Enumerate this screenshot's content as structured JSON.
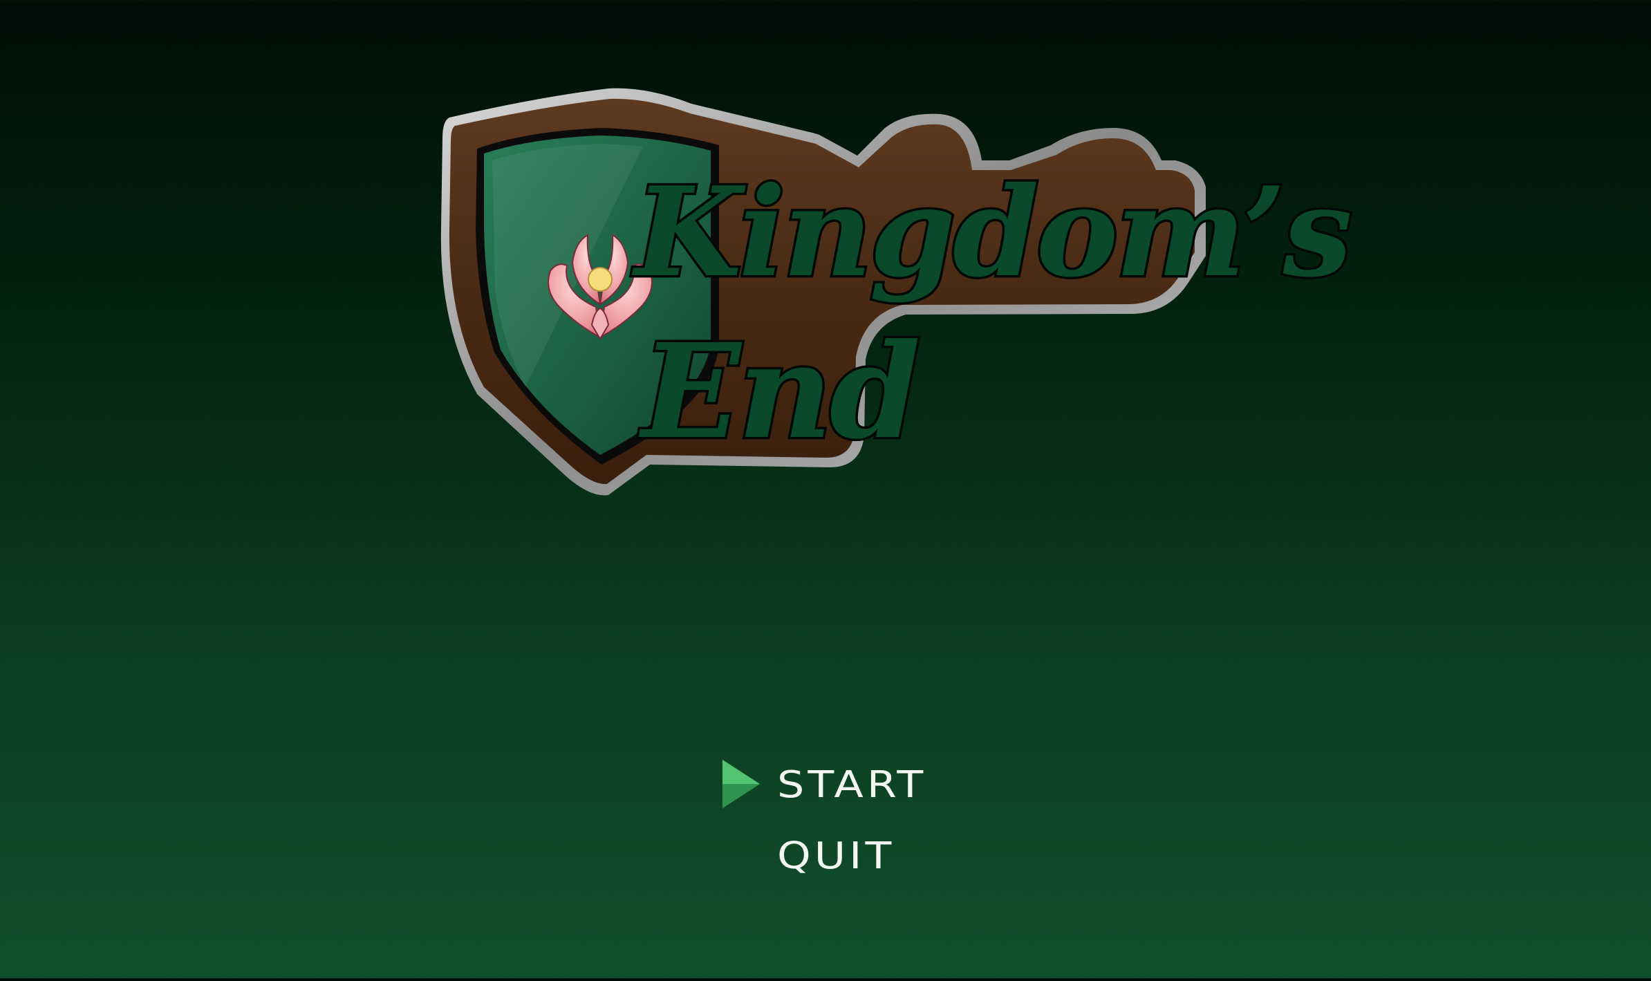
{
  "logo": {
    "title_line1": "Kingdom’s",
    "title_line2": "End"
  },
  "menu": {
    "items": [
      {
        "label": "START",
        "selected": true
      },
      {
        "label": "QUIT",
        "selected": false
      }
    ]
  },
  "colors": {
    "background_top": "#000e07",
    "background_bottom": "#134f2b",
    "banner_brown": "#57321a",
    "banner_frame": "#9c9c9c",
    "shield_green": "#1f6a4b",
    "emblem_pink": "#f0a7aa",
    "emblem_gold": "#f6dc7a",
    "selector_green": "#3fb060",
    "menu_text": "#f4f6f4"
  },
  "icons": {
    "emblem": "phoenix-flame-emblem",
    "selector": "play-triangle-icon"
  }
}
